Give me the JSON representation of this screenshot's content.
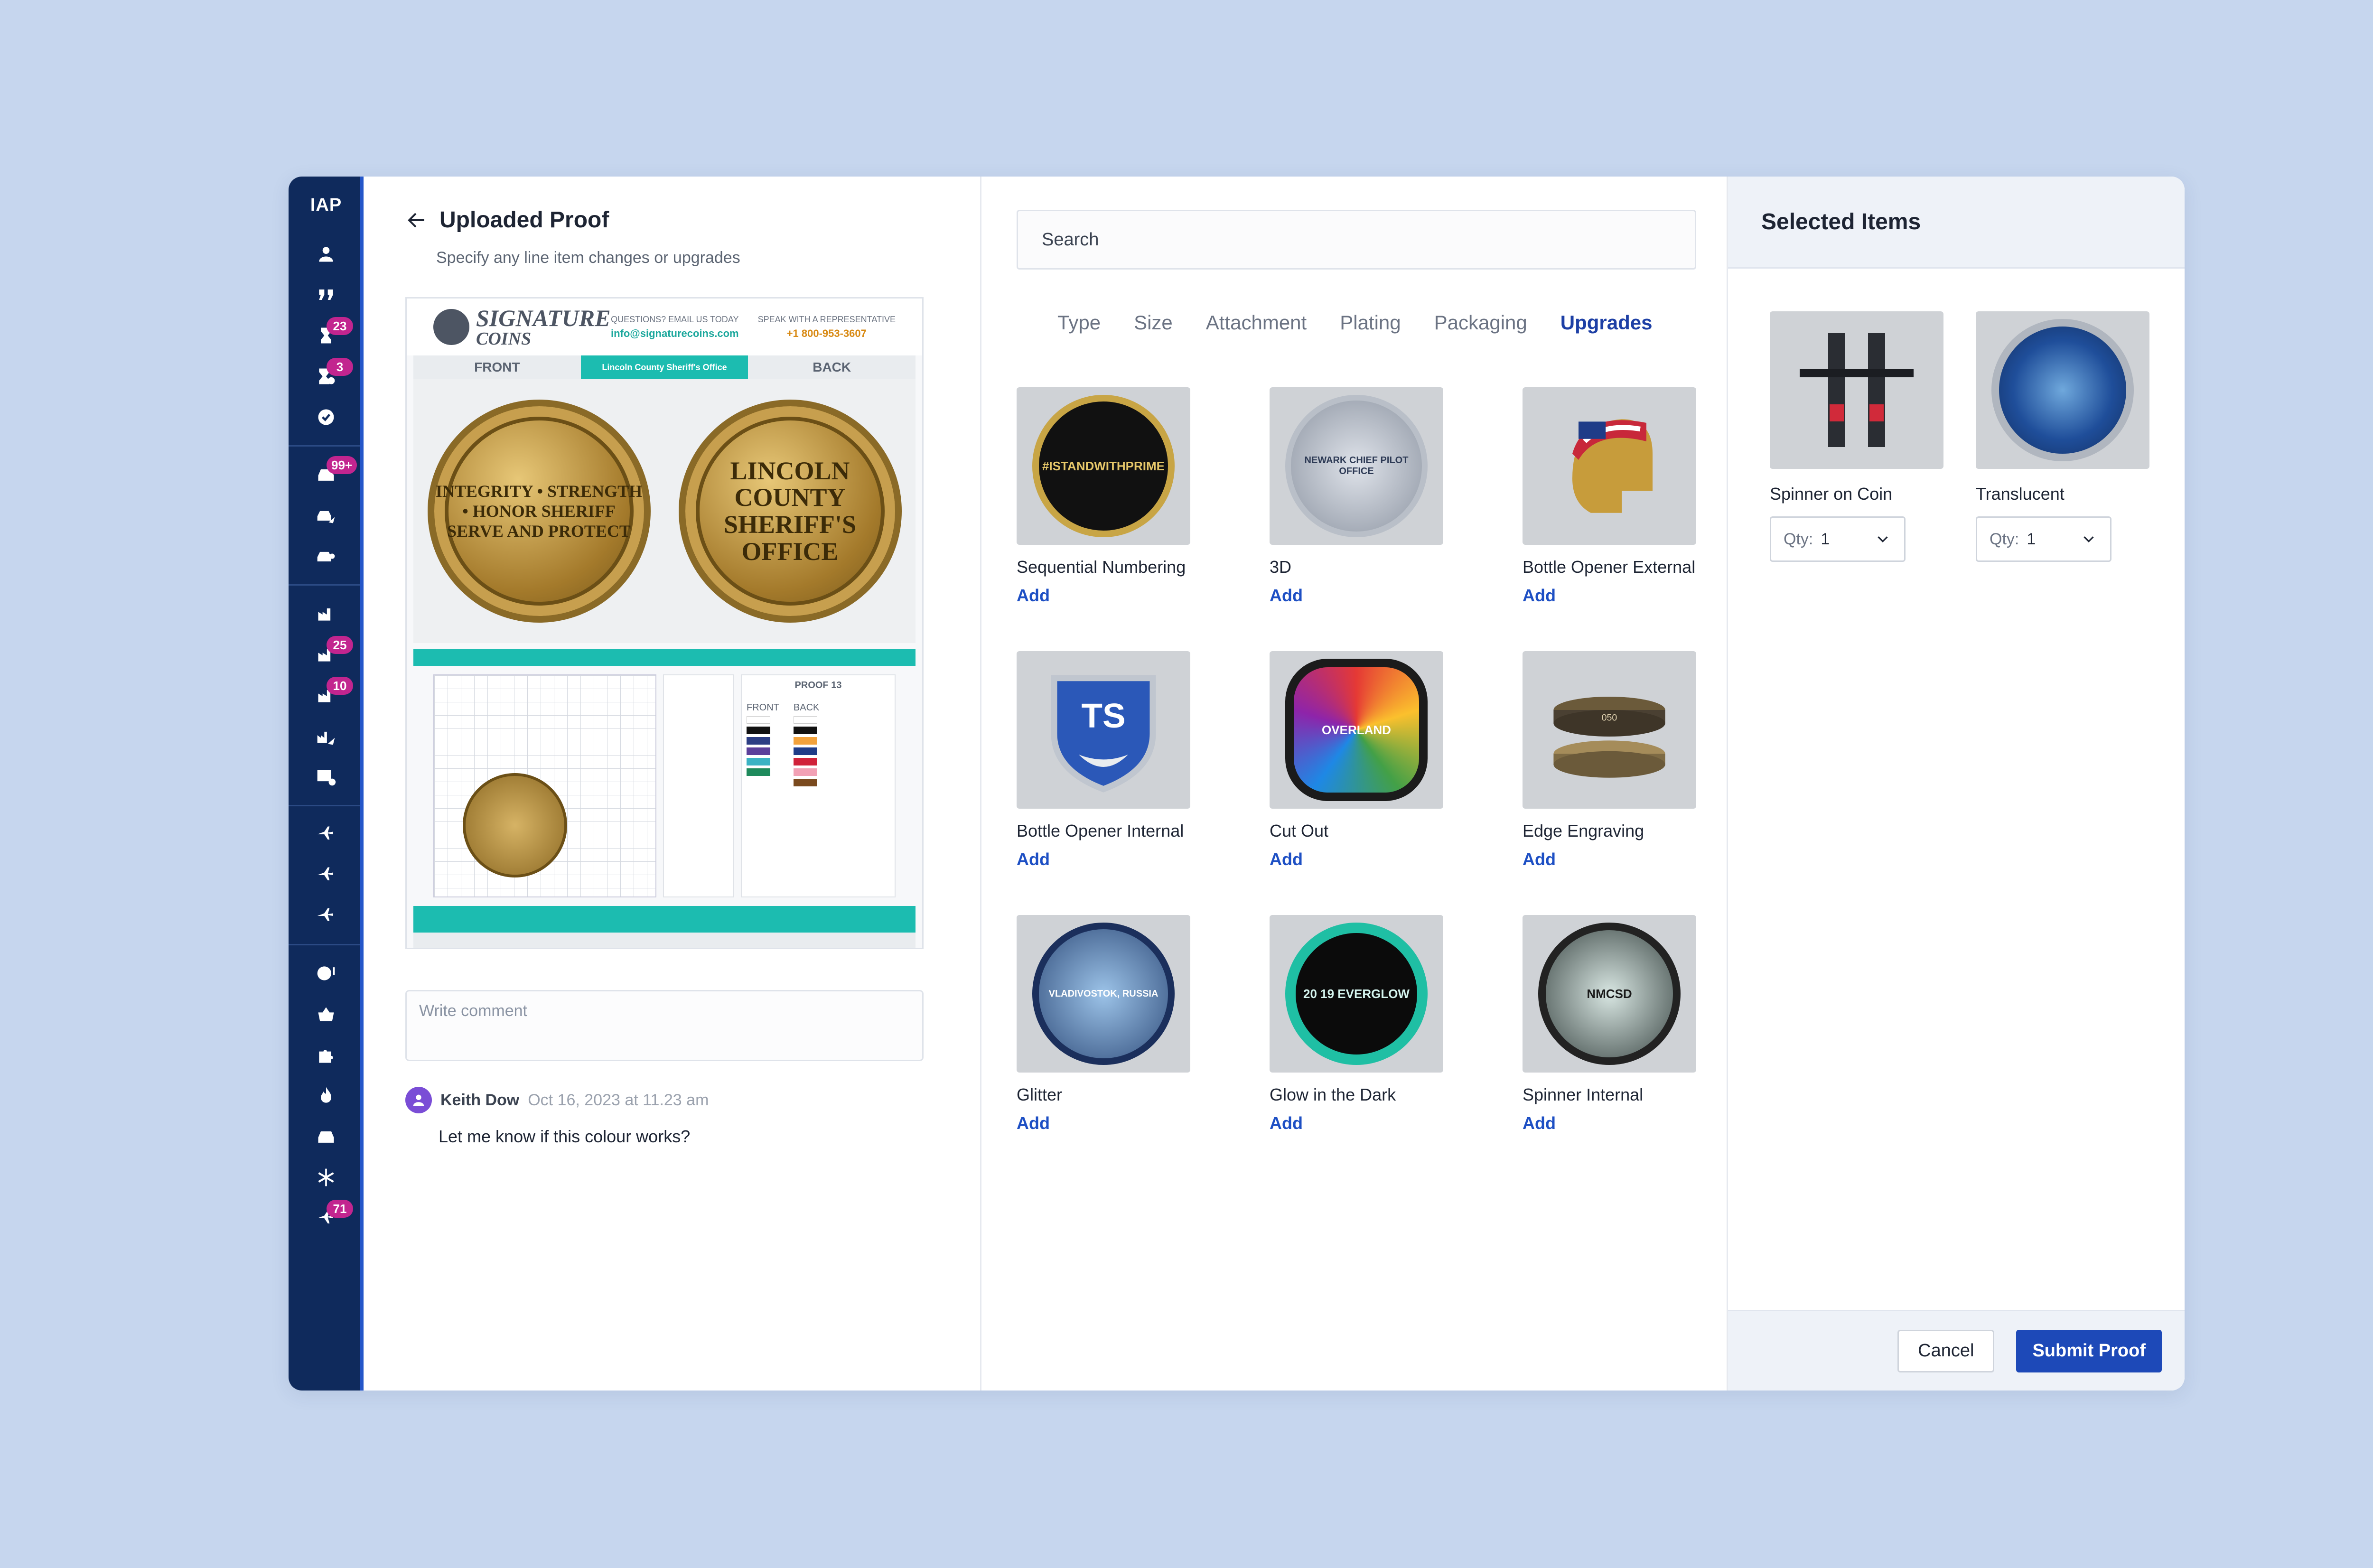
{
  "sidebar": {
    "brand": "IAP",
    "badges": {
      "sandglass": "23",
      "sandglass_alt": "3",
      "inbox": "99+",
      "tools_a": "25",
      "tools_b": "10",
      "plane": "71"
    }
  },
  "left": {
    "title": "Uploaded Proof",
    "subtitle": "Specify any line item changes or upgrades",
    "proof": {
      "logo_top": "SIGNATURE",
      "logo_bottom": "COINS",
      "email_label": "QUESTIONS? EMAIL US TODAY",
      "email": "info@signaturecoins.com",
      "rep_label": "SPEAK WITH A REPRESENTATIVE",
      "phone": "+1 800-953-3607",
      "front_label": "FRONT",
      "tab_label": "Lincoln County Sheriff's Office",
      "back_label": "BACK",
      "front_coin_text": "INTEGRITY • STRENGTH • HONOR SHERIFF SERVE AND PROTECT",
      "back_coin_text": "LINCOLN COUNTY SHERIFF'S OFFICE",
      "proof_number": "PROOF 13",
      "front_col": "FRONT",
      "back_col": "BACK"
    },
    "comment_placeholder": "Write comment",
    "comment": {
      "author": "Keith Dow",
      "date": "Oct 16, 2023 at 11.23 am",
      "text": "Let me know if this colour works?"
    }
  },
  "middle": {
    "search_placeholder": "Search",
    "tabs": [
      "Type",
      "Size",
      "Attachment",
      "Plating",
      "Packaging",
      "Upgrades"
    ],
    "active_tab": "Upgrades",
    "add_label": "Add",
    "products": [
      {
        "name": "Sequential Numbering",
        "coin_text": "#ISTANDWITHPRIME"
      },
      {
        "name": "3D",
        "coin_text": "NEWARK CHIEF PILOT OFFICE"
      },
      {
        "name": "Bottle Opener External",
        "coin_text": ""
      },
      {
        "name": "Bottle Opener Internal",
        "coin_text": ""
      },
      {
        "name": "Cut Out",
        "coin_text": "OVERLAND"
      },
      {
        "name": "Edge Engraving",
        "coin_text": "050"
      },
      {
        "name": "Glitter",
        "coin_text": "VLADIVOSTOK, RUSSIA"
      },
      {
        "name": "Glow in the Dark",
        "coin_text": "20 19 EVERGLOW"
      },
      {
        "name": "Spinner Internal",
        "coin_text": "NMCSD"
      }
    ]
  },
  "right": {
    "title": "Selected  Items",
    "qty_label": "Qty:",
    "items": [
      {
        "name": "Spinner on Coin",
        "qty": "1"
      },
      {
        "name": "Translucent",
        "qty": "1"
      }
    ],
    "cancel_label": "Cancel",
    "submit_label": "Submit Proof"
  },
  "colors": {
    "sidebar": "#0f2a5c",
    "accent": "#1d49b8",
    "badge": "#c2258f",
    "teal": "#1cbcb0"
  }
}
